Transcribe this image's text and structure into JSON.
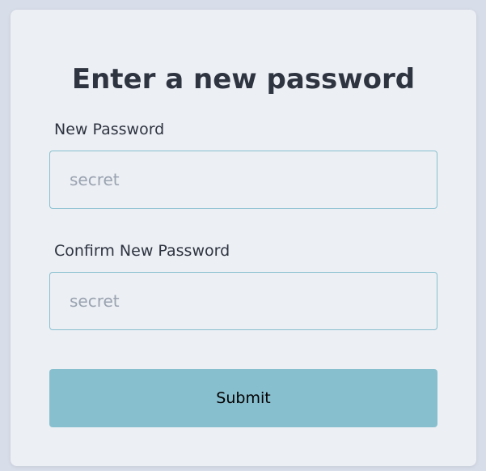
{
  "page": {
    "title": "Enter a new password"
  },
  "form": {
    "new_password": {
      "label": "New Password",
      "value": "",
      "placeholder": "secret"
    },
    "confirm_password": {
      "label": "Confirm New Password",
      "value": "",
      "placeholder": "secret"
    },
    "submit_label": "Submit"
  },
  "colors": {
    "background": "#d8dee9",
    "card": "#eceff4",
    "text": "#2e3440",
    "input_border": "#88c0d0",
    "button": "#88bfcf"
  }
}
